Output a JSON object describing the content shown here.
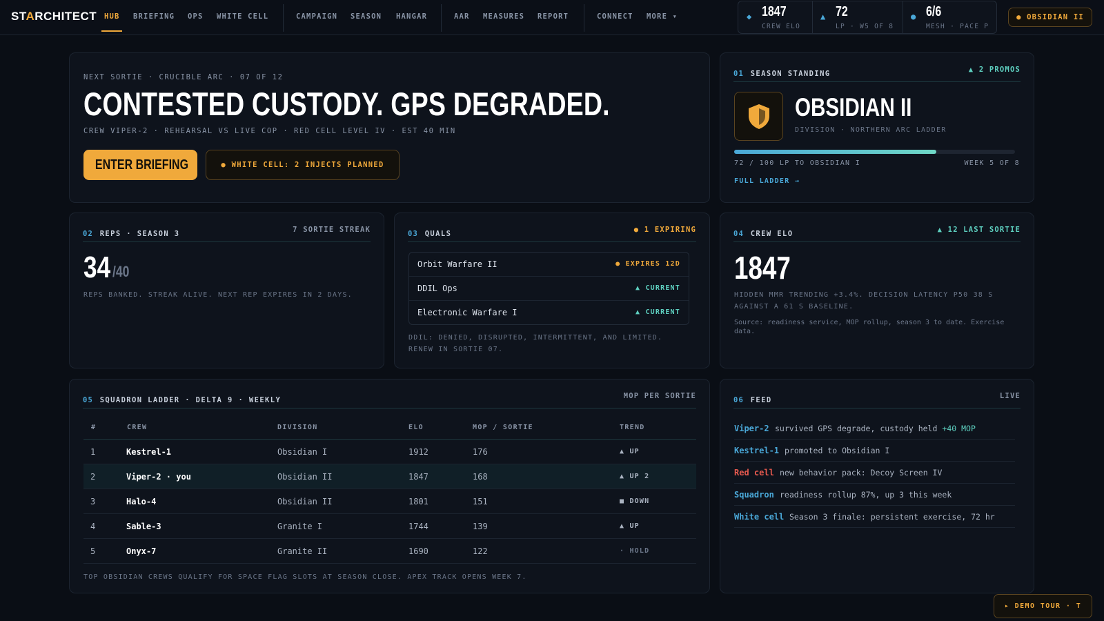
{
  "nav": {
    "logo_a": "STAR",
    "logo_b": "CHITECT",
    "logo_accent_index": 2,
    "items": [
      "HUB",
      "BRIEFING",
      "OPS",
      "WHITE CELL",
      "CAMPAIGN",
      "SEASON",
      "HANGAR",
      "AAR",
      "MEASURES",
      "REPORT",
      "CONNECT",
      "MORE ▾"
    ],
    "active": "HUB"
  },
  "stats": {
    "elo": {
      "icon": "◆",
      "value": "1847",
      "label": "CREW ELO"
    },
    "lp": {
      "icon": "▲",
      "value": "72",
      "label": "LP · W5 OF 8"
    },
    "mesh": {
      "icon": "●",
      "value": "6/6",
      "label": "MESH · PACE P"
    }
  },
  "rank_pill": "● OBSIDIAN II",
  "hero": {
    "kicker": "NEXT SORTIE · CRUCIBLE ARC · 07 OF 12",
    "title": "CONTESTED CUSTODY. GPS DEGRADED.",
    "sub": "CREW VIPER-2 · REHEARSAL VS LIVE COP · RED CELL LEVEL IV · EST 40 MIN",
    "primary_btn": "ENTER BRIEFING",
    "secondary_btn": "● WHITE CELL: 2 INJECTS PLANNED"
  },
  "standing": {
    "num": "01",
    "title": "SEASON STANDING",
    "right": "▲ 2 PROMOS",
    "tier": "OBSIDIAN II",
    "tier_sub": "DIVISION · NORTHERN ARC LADDER",
    "progress": 0.72,
    "progress_text": "72 / 100 LP TO OBSIDIAN I",
    "week_text": "WEEK 5 OF 8",
    "link": "FULL LADDER →"
  },
  "reps": {
    "num": "02",
    "title": "REPS · SEASON 3",
    "right": "7 SORTIE STREAK",
    "value": "34",
    "total": "/40",
    "text": "REPS BANKED. STREAK ALIVE. NEXT REP EXPIRES IN 2 DAYS."
  },
  "quals": {
    "num": "03",
    "title": "QUALS",
    "right": "● 1 EXPIRING",
    "items": [
      {
        "name": "Orbit Warfare II",
        "status": "● EXPIRES 12D",
        "tone": "amber"
      },
      {
        "name": "DDIL Ops",
        "status": "▲ CURRENT",
        "tone": "teal"
      },
      {
        "name": "Electronic Warfare I",
        "status": "▲ CURRENT",
        "tone": "teal"
      }
    ],
    "note": "DDIL: DENIED, DISRUPTED, INTERMITTENT, AND LIMITED. RENEW IN SORTIE 07."
  },
  "crew_elo": {
    "num": "04",
    "title": "CREW ELO",
    "right": "▲ 12 LAST SORTIE",
    "value": "1847",
    "text": "HIDDEN MMR TRENDING +3.4%. DECISION LATENCY P50 38 S AGAINST A 61 S BASELINE.",
    "source": "Source: readiness service, MOP rollup, season 3 to date. Exercise data."
  },
  "ladder": {
    "num": "05",
    "title": "SQUADRON LADDER · DELTA 9 · WEEKLY",
    "right": "MOP PER SORTIE",
    "columns": [
      "#",
      "CREW",
      "DIVISION",
      "ELO",
      "MOP / SORTIE",
      "TREND"
    ],
    "rows": [
      {
        "rank": "1",
        "crew": "Kestrel-1",
        "division": "Obsidian I",
        "elo": "1912",
        "mop": "176",
        "trend": "▲ UP",
        "tone": "teal",
        "you": false
      },
      {
        "rank": "2",
        "crew": "Viper-2 · you",
        "division": "Obsidian II",
        "elo": "1847",
        "mop": "168",
        "trend": "▲ UP 2",
        "tone": "teal",
        "you": true
      },
      {
        "rank": "3",
        "crew": "Halo-4",
        "division": "Obsidian II",
        "elo": "1801",
        "mop": "151",
        "trend": "■ DOWN",
        "tone": "red",
        "you": false
      },
      {
        "rank": "4",
        "crew": "Sable-3",
        "division": "Granite I",
        "elo": "1744",
        "mop": "139",
        "trend": "▲ UP",
        "tone": "teal",
        "you": false
      },
      {
        "rank": "5",
        "crew": "Onyx-7",
        "division": "Granite II",
        "elo": "1690",
        "mop": "122",
        "trend": "· HOLD",
        "tone": "muted",
        "you": false
      }
    ],
    "footer": "TOP OBSIDIAN CREWS QUALIFY FOR SPACE FLAG SLOTS AT SEASON CLOSE. APEX TRACK OPENS WEEK 7."
  },
  "feed": {
    "num": "06",
    "title": "FEED",
    "right": "LIVE",
    "items": [
      {
        "actor": "Viper-2",
        "tone": "blue",
        "msg": "survived GPS degrade, custody held",
        "extra": "+40 MOP"
      },
      {
        "actor": "Kestrel-1",
        "tone": "blue",
        "msg": "promoted to Obsidian I",
        "extra": ""
      },
      {
        "actor": "Red cell",
        "tone": "red",
        "msg": "new behavior pack: Decoy Screen IV",
        "extra": ""
      },
      {
        "actor": "Squadron",
        "tone": "blue",
        "msg": "readiness rollup 87%, up 3 this week",
        "extra": ""
      },
      {
        "actor": "White cell",
        "tone": "blue",
        "msg": "Season 3 finale: persistent exercise, 72 hr",
        "extra": ""
      }
    ]
  },
  "demo_pill": "▸ DEMO TOUR · T",
  "colors": {
    "accent": "#f0a93b",
    "teal": "#5ed0c0",
    "blue": "#4aa8d8",
    "red": "#e85a4f",
    "bg": "#0a0e15"
  }
}
